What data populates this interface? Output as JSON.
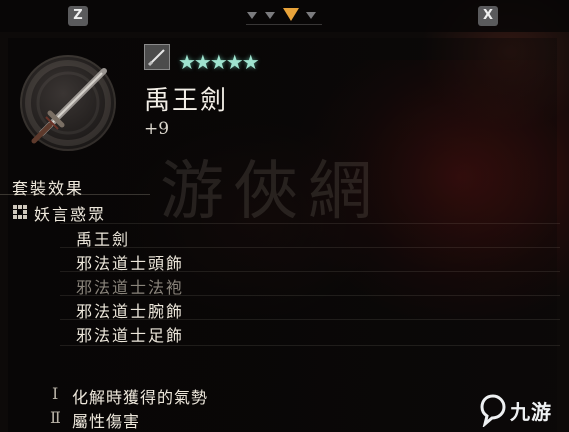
{
  "topbar": {
    "left_key": "Z",
    "right_key": "X"
  },
  "item": {
    "rarity_stars": "★★★★★",
    "name": "禹王劍",
    "upgrade": "+9",
    "weapon_type_icon": "sword-type-icon"
  },
  "watermark": "游俠網",
  "set": {
    "header": "套裝效果",
    "name": "妖言惑眾",
    "pieces": [
      {
        "label": "禹王劍",
        "equipped": true
      },
      {
        "label": "邪法道士頭飾",
        "equipped": true
      },
      {
        "label": "邪法道士法袍",
        "equipped": false
      },
      {
        "label": "邪法道士腕飾",
        "equipped": true
      },
      {
        "label": "邪法道士足飾",
        "equipped": true
      }
    ],
    "effects": [
      {
        "numeral": "Ⅰ",
        "text": "化解時獲得的氣勢"
      },
      {
        "numeral": "Ⅱ",
        "text": "屬性傷害"
      }
    ]
  },
  "logo": {
    "text": "九游"
  },
  "colors": {
    "accent": "#e8a33a",
    "stars": "#9fe3cf",
    "text": "#ede7db",
    "dim_text": "#8a847b"
  }
}
